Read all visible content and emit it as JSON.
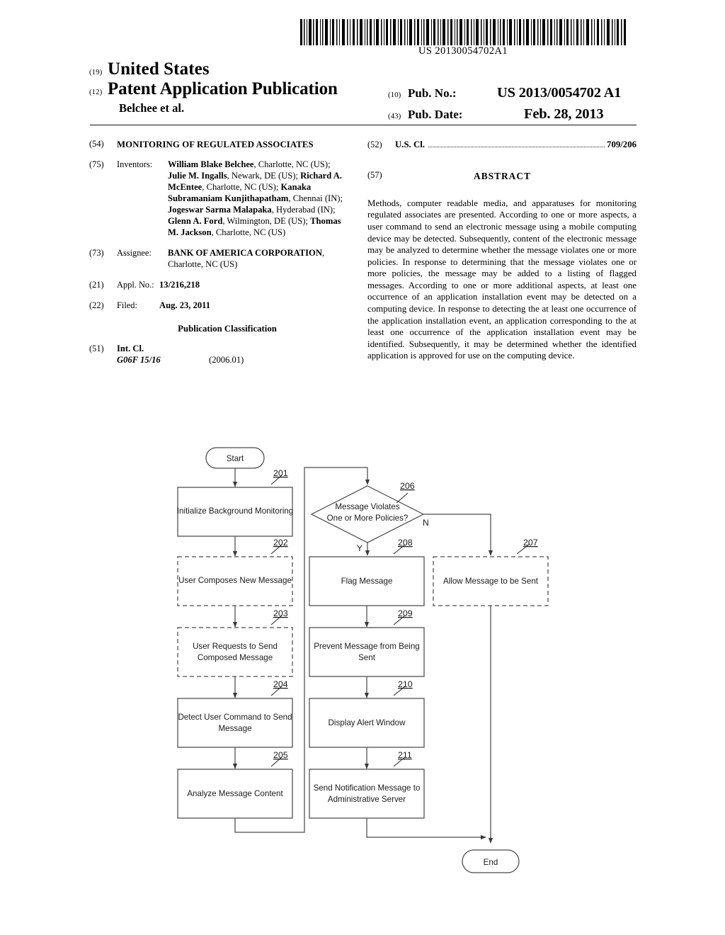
{
  "header": {
    "barcode_number": "US 20130054702A1",
    "code_19": "(19)",
    "country": "United States",
    "code_12": "(12)",
    "doc_type": "Patent Application Publication",
    "authors": "Belchee et al.",
    "code_10": "(10)",
    "pub_no_label": "Pub. No.:",
    "pub_no_value": "US 2013/0054702 A1",
    "code_43": "(43)",
    "pub_date_label": "Pub. Date:",
    "pub_date_value": "Feb. 28, 2013"
  },
  "left_column": {
    "title": {
      "code": "(54)",
      "text": "MONITORING OF REGULATED ASSOCIATES"
    },
    "inventors": {
      "code": "(75)",
      "label": "Inventors:",
      "text": "William Blake Belchee, Charlotte, NC (US); Julie M. Ingalls, Newark, DE (US); Richard A. McEntee, Charlotte, NC (US); Kanaka Subramaniam Kunjithapatham, Chennai (IN); Jogeswar Sarma Malapaka, Hyderabad (IN); Glenn A. Ford, Wilmington, DE (US); Thomas M. Jackson, Charlotte, NC (US)"
    },
    "assignee": {
      "code": "(73)",
      "label": "Assignee:",
      "name": "BANK OF AMERICA CORPORATION",
      "location": ", Charlotte, NC (US)"
    },
    "appl_no": {
      "code": "(21)",
      "label": "Appl. No.:",
      "value": "13/216,218"
    },
    "filed": {
      "code": "(22)",
      "label": "Filed:",
      "value": "Aug. 23, 2011"
    },
    "publication_classification": "Publication Classification",
    "int_cl": {
      "code": "(51)",
      "label": "Int. Cl.",
      "symbol": "G06F 15/16",
      "version": "(2006.01)"
    }
  },
  "right_column": {
    "us_cl": {
      "code": "(52)",
      "label": "U.S. Cl.",
      "value": "709/206"
    },
    "abstract": {
      "code": "(57)",
      "title": "ABSTRACT",
      "text": "Methods, computer readable media, and apparatuses for monitoring regulated associates are presented. According to one or more aspects, a user command to send an electronic message using a mobile computing device may be detected. Subsequently, content of the electronic message may be analyzed to determine whether the message violates one or more policies. In response to determining that the message violates one or more policies, the message may be added to a listing of flagged messages. According to one or more additional aspects, at least one occurrence of an application installation event may be detected on a computing device. In response to detecting the at least one occurrence of the application installation event, an application corresponding to the at least one occurrence of the application installation event may be identified. Subsequently, it may be determined whether the identified application is approved for use on the computing device."
    }
  },
  "flowchart": {
    "start_label": "Start",
    "end_label": "End",
    "yes_label": "Y",
    "no_label": "N",
    "nodes": [
      {
        "ref": "201",
        "label": "Initialize Background Monitoring",
        "style": "solid",
        "shape": "rect"
      },
      {
        "ref": "202",
        "label": "User Composes New Message",
        "style": "dashed",
        "shape": "rect"
      },
      {
        "ref": "203",
        "label": "User Requests to Send Composed Message",
        "style": "dashed",
        "shape": "rect"
      },
      {
        "ref": "204",
        "label": "Detect User Command to Send Message",
        "style": "solid",
        "shape": "rect"
      },
      {
        "ref": "205",
        "label": "Analyze Message Content",
        "style": "solid",
        "shape": "rect"
      },
      {
        "ref": "206",
        "label": "Message Violates One or More Policies?",
        "style": "solid",
        "shape": "diamond"
      },
      {
        "ref": "207",
        "label": "Allow Message to be Sent",
        "style": "dashed",
        "shape": "rect"
      },
      {
        "ref": "208",
        "label": "Flag Message",
        "style": "solid",
        "shape": "rect"
      },
      {
        "ref": "209",
        "label": "Prevent Message from Being Sent",
        "style": "solid",
        "shape": "rect"
      },
      {
        "ref": "210",
        "label": "Display Alert Window",
        "style": "solid",
        "shape": "rect"
      },
      {
        "ref": "211",
        "label": "Send Notification Message to Administrative Server",
        "style": "solid",
        "shape": "rect"
      }
    ]
  }
}
